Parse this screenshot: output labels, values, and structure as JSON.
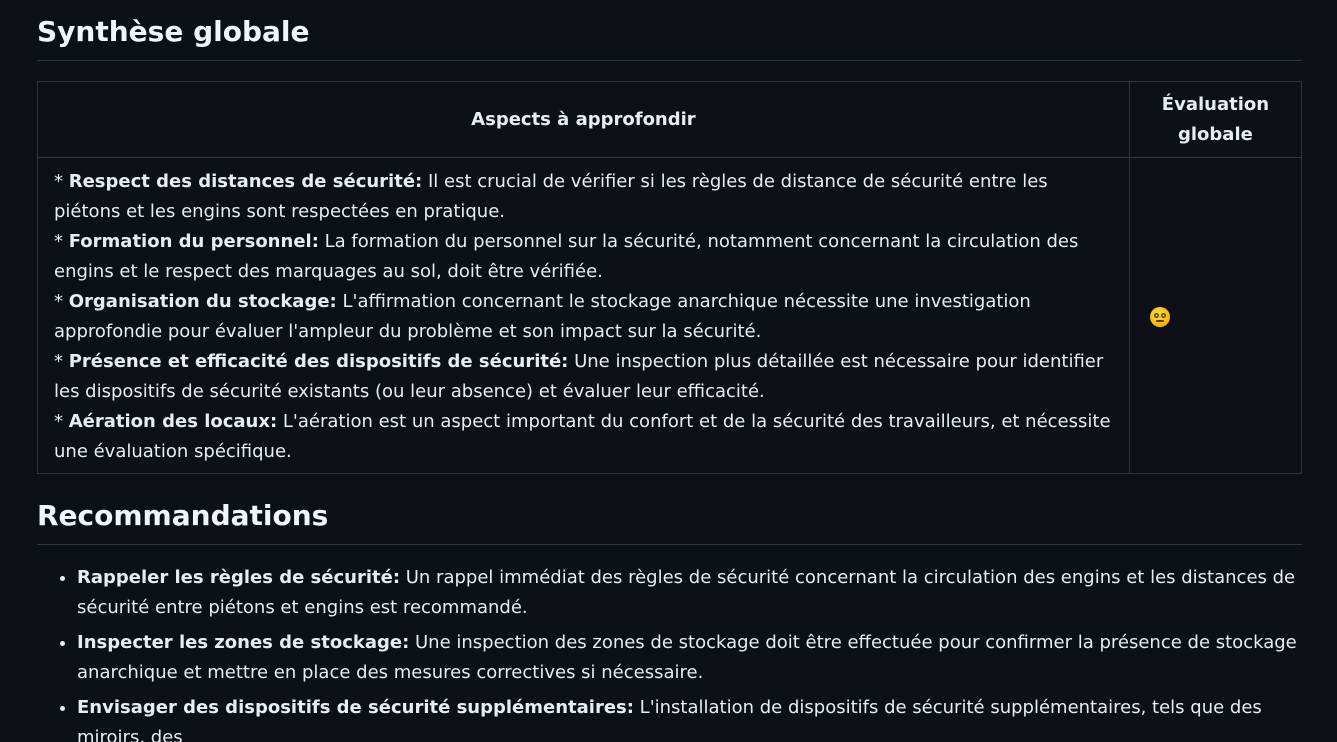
{
  "synthese": {
    "title": "Synthèse globale",
    "table": {
      "headers": [
        "Aspects à approfondir",
        "Évaluation globale"
      ],
      "items": [
        {
          "label": "Respect des distances de sécurité:",
          "text": " Il est crucial de vérifier si les règles de distance de sécurité entre les piétons et les engins sont respectées en pratique."
        },
        {
          "label": "Formation du personnel:",
          "text": " La formation du personnel sur la sécurité, notamment concernant la circulation des engins et le respect des marquages au sol, doit être vérifiée."
        },
        {
          "label": "Organisation du stockage:",
          "text": " L'affirmation concernant le stockage anarchique nécessite une investigation approfondie pour évaluer l'ampleur du problème et son impact sur la sécurité."
        },
        {
          "label": "Présence et efficacité des dispositifs de sécurité:",
          "text": " Une inspection plus détaillée est nécessaire pour identifier les dispositifs de sécurité existants (ou leur absence) et évaluer leur efficacité."
        },
        {
          "label": "Aération des locaux:",
          "text": " L'aération est un aspect important du confort et de la sécurité des travailleurs, et nécessite une évaluation spécifique."
        }
      ],
      "bullet_prefix": "* ",
      "evaluation_icon": "neutral-face-emoji"
    }
  },
  "recommandations": {
    "title": "Recommandations",
    "items": [
      {
        "label": "Rappeler les règles de sécurité:",
        "text": " Un rappel immédiat des règles de sécurité concernant la circulation des engins et les distances de sécurité entre piétons et engins est recommandé."
      },
      {
        "label": "Inspecter les zones de stockage:",
        "text": " Une inspection des zones de stockage doit être effectuée pour confirmer la présence de stockage anarchique et mettre en place des mesures correctives si nécessaire."
      },
      {
        "label": "Envisager des dispositifs de sécurité supplémentaires:",
        "text": " L'installation de dispositifs de sécurité supplémentaires, tels que des miroirs, des"
      }
    ]
  }
}
